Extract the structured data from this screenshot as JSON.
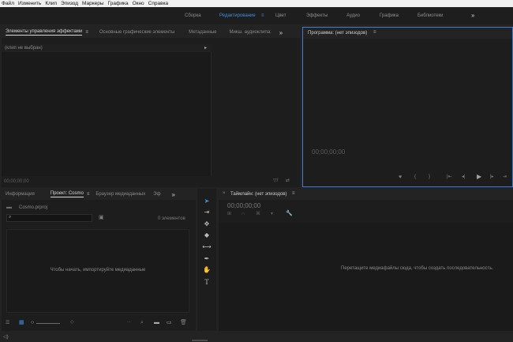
{
  "menu": [
    "Файл",
    "Изменить",
    "Клип",
    "Эпизод",
    "Маркеры",
    "Графика",
    "Окно",
    "Справка"
  ],
  "workspaces": {
    "items": [
      {
        "label": "Сборка",
        "active": false
      },
      {
        "label": "Редактирование",
        "active": true
      },
      {
        "label": "Цвет",
        "active": false
      },
      {
        "label": "Эффекты",
        "active": false
      },
      {
        "label": "Аудио",
        "active": false
      },
      {
        "label": "Графика",
        "active": false
      },
      {
        "label": "Библиотеки",
        "active": false
      }
    ],
    "overflow": "»"
  },
  "source_panel": {
    "tabs": [
      "Элементы управления эффектами",
      "Основные графические элементы",
      "Метаданные",
      "Микш. аудиоклипа:"
    ],
    "clip_status": "(клип не выбран)",
    "timecode": "00;00;00;00"
  },
  "program_panel": {
    "title": "Программа: (нет эпизодов)",
    "timecode": "00;00;00;00"
  },
  "project_panel": {
    "tabs": [
      "Информация",
      "Проект: Cosmo",
      "Браузер медиаданных",
      "Эф"
    ],
    "file_name": "Cosmo.prproj",
    "search_value": "",
    "item_count": "0 элементов",
    "empty_message": "Чтобы начать, импортируйте медиаданные"
  },
  "timeline_panel": {
    "title": "Таймлайн: (нет эпизодов)",
    "timecode": "00;00;00;00",
    "empty_message": "Перетащите медиафайлы сюда, чтобы создать последовательность."
  },
  "colors": {
    "accent": "#3c8fde",
    "panel_bg": "#1d1d1d",
    "app_bg": "#232323",
    "highlight_border": "#3b7ddd"
  },
  "icons": {
    "hamburger": "menu-icon",
    "overflow": "chevron-double-right-icon",
    "tools": [
      "selection-tool-icon",
      "track-select-icon",
      "ripple-edit-icon",
      "razor-icon",
      "slip-icon",
      "pen-icon",
      "hand-icon",
      "type-icon"
    ]
  }
}
